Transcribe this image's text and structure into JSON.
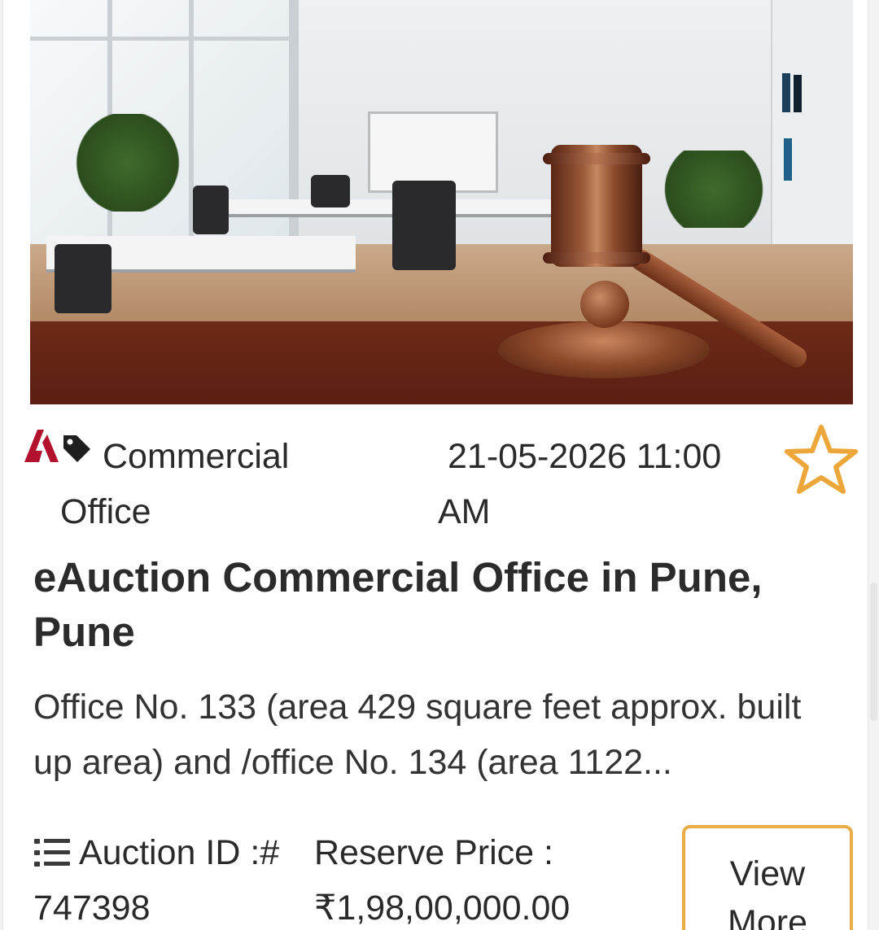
{
  "listing": {
    "category": "Commercial Office",
    "auction_datetime": "21-05-2026 11:00 AM",
    "title": "eAuction Commercial Office in Pune, Pune",
    "description": "Office No. 133 (area 429 square feet approx. built up area) and /office No. 134 (area 1122...",
    "auction_id_label": "Auction ID :#",
    "auction_id": "747398",
    "reserve_price_label": "Reserve Price :",
    "reserve_price": "₹1,98,00,000.00",
    "view_more_label": "View More"
  },
  "icons": {
    "brand": "brand-logo-icon",
    "tag": "tag-icon",
    "favorite": "star-outline-icon",
    "list": "list-icon"
  },
  "colors": {
    "brand_red": "#b3122e",
    "star_accent": "#eda63a",
    "button_border": "#e9ad48",
    "title_text": "#2b2b2b"
  }
}
